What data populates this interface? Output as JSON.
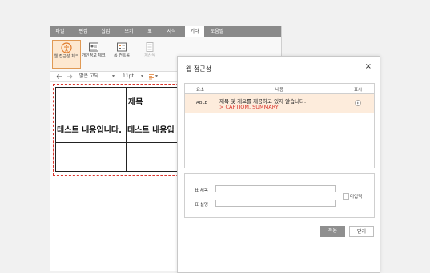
{
  "menubar": {
    "items": [
      "파일",
      "편집",
      "삽입",
      "보기",
      "표",
      "서식",
      "기타",
      "도움말"
    ],
    "active_index": 6
  },
  "ribbon": {
    "buttons": [
      {
        "label": "웹 접근성 체크"
      },
      {
        "label": "개인정보 체크"
      },
      {
        "label": "폼 컨트롤"
      },
      {
        "label": "계산식"
      }
    ]
  },
  "toolbar": {
    "undo_icon": "undo-icon",
    "redo_icon": "redo-icon",
    "font_name": "맑은 고딕",
    "font_size": "11pt"
  },
  "document": {
    "header_cell": "제목",
    "body_cells": [
      "테스트 내용입니다.",
      "테스트 내용입"
    ]
  },
  "dialog": {
    "title": "웹 접근성",
    "close": "×",
    "columns": [
      "요소",
      "내용",
      "표시"
    ],
    "row": {
      "element": "TABLE",
      "message": "제목 및 개요를 제공하고 있지 않습니다.",
      "detail": "> CAPTIOM, SUMMARY"
    },
    "form": {
      "title_label": "표 제목",
      "desc_label": "표 설명",
      "checkbox_label": "미입력"
    },
    "apply_label": "적용",
    "close_label": "닫기"
  },
  "colors": {
    "accent": "#e09a55",
    "error": "#d9332a",
    "apply_button": "#8f8f8f"
  }
}
